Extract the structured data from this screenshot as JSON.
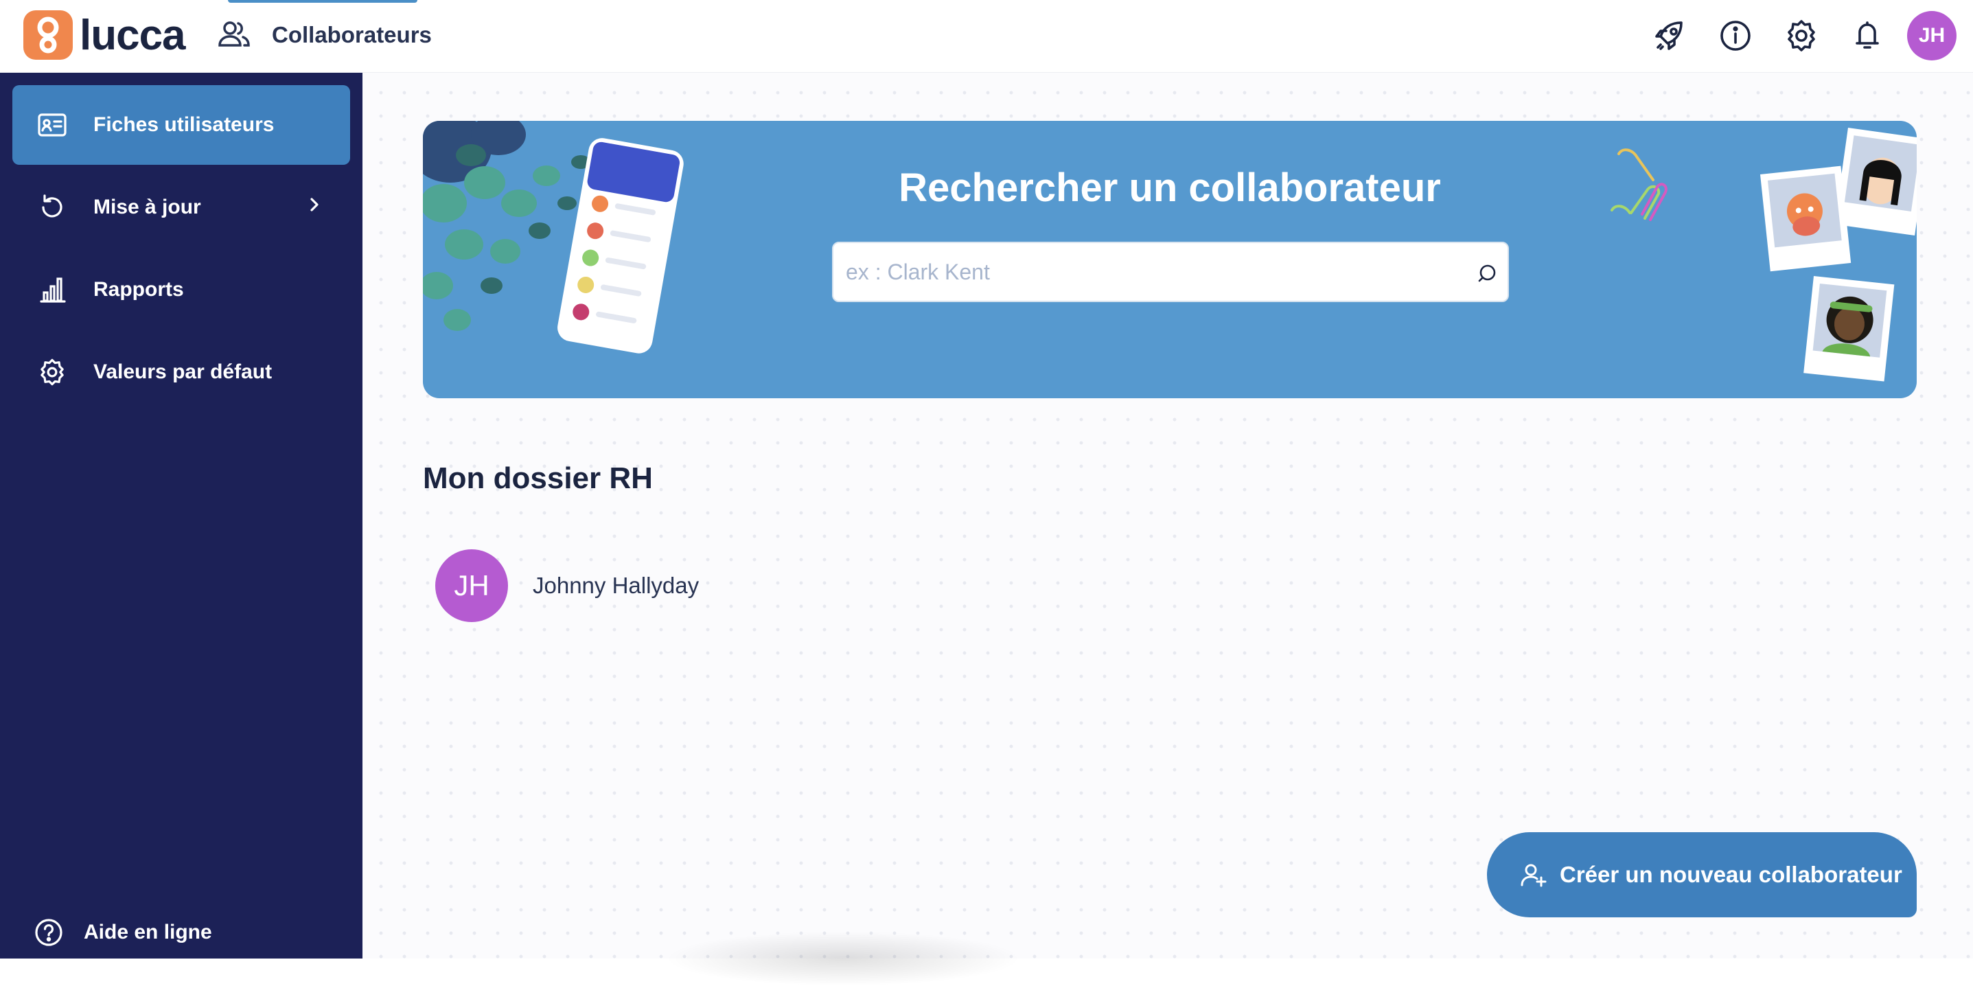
{
  "header": {
    "logo_text": "lucca",
    "app_title": "Collaborateurs",
    "avatar_initials": "JH",
    "icons": [
      "rocket-icon",
      "info-icon",
      "settings-icon",
      "bell-icon"
    ]
  },
  "sidebar": {
    "items": [
      {
        "label": "Fiches utilisateurs",
        "icon": "id-card-icon",
        "active": true
      },
      {
        "label": "Mise à jour",
        "icon": "refresh-icon",
        "has_submenu": true
      },
      {
        "label": "Rapports",
        "icon": "bar-chart-icon"
      },
      {
        "label": "Valeurs par défaut",
        "icon": "settings-icon"
      }
    ],
    "help_label": "Aide en ligne"
  },
  "banner": {
    "title": "Rechercher un collaborateur",
    "search_placeholder": "ex : Clark Kent",
    "search_value": ""
  },
  "dossier": {
    "title": "Mon dossier RH",
    "person_initials": "JH",
    "person_name": "Johnny Hallyday"
  },
  "actions": {
    "create_label": "Créer un nouveau collaborateur"
  },
  "colors": {
    "sidebar_bg": "#1c2157",
    "accent": "#3f80bd",
    "banner_bg": "#5699cf",
    "avatar": "#b55bd1",
    "logo": "#f0874d"
  }
}
